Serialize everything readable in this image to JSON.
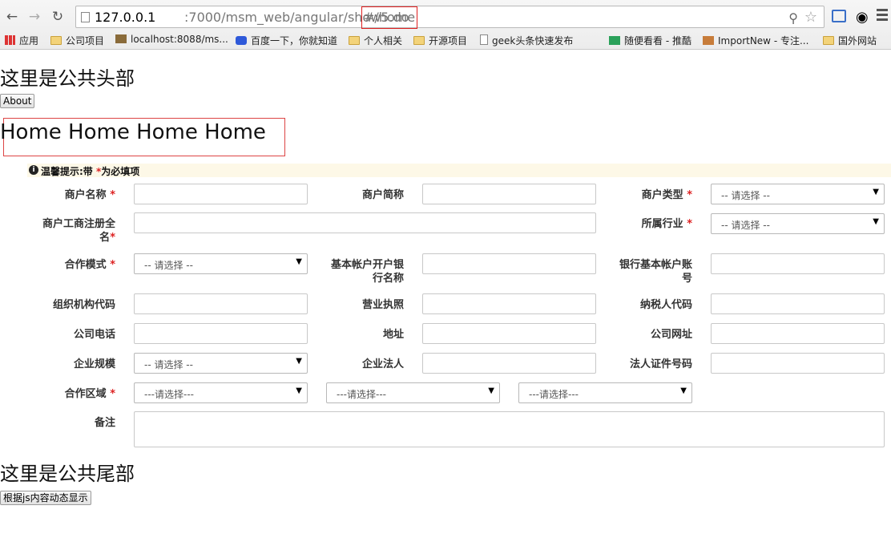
{
  "browser": {
    "back_icon": "back-arrow-icon",
    "forward_icon": "forward-arrow-icon",
    "reload_icon": "reload-icon",
    "url_host": "127.0.0.1",
    "url_path": ":7000/msm_web/angular/show5.do",
    "url_hash": "#/home",
    "bookmarks": [
      {
        "label": "应用",
        "icon": "apps-icon"
      },
      {
        "label": "公司项目",
        "icon": "folder-icon"
      },
      {
        "label": "localhost:8088/ms...",
        "icon": "favicon-icon"
      },
      {
        "label": "百度一下，你就知道",
        "icon": "paw-icon"
      },
      {
        "label": "个人相关",
        "icon": "folder-icon"
      },
      {
        "label": "开源项目",
        "icon": "folder-icon"
      },
      {
        "label": "geek头条快速发布",
        "icon": "page-icon"
      },
      {
        "label": "随便看看 - 推酷",
        "icon": "tuicool-icon"
      },
      {
        "label": "ImportNew - 专注...",
        "icon": "java-icon"
      },
      {
        "label": "国外网站",
        "icon": "folder-icon"
      }
    ]
  },
  "header": {
    "title": "这里是公共头部",
    "about_button": "About"
  },
  "home": {
    "heading": "Home Home Home Home"
  },
  "form": {
    "tip_icon": "info-icon",
    "tip_text_prefix": "温馨提示:带 ",
    "tip_star": "*",
    "tip_text_suffix": "为必填项",
    "required_mark": "*",
    "select_placeholder": "-- 请选择 --",
    "region_placeholder": "---请选择---",
    "labels": {
      "merchant_name": "商户名称",
      "merchant_short": "商户简称",
      "merchant_type": "商户类型",
      "merchant_reg_name_1": "商户工商注册全",
      "merchant_reg_name_2": "名",
      "industry": "所属行业",
      "coop_mode": "合作模式",
      "bank_name_1": "基本帐户开户银",
      "bank_name_2": "行名称",
      "bank_account_1": "银行基本帐户账",
      "bank_account_2": "号",
      "org_code": "组织机构代码",
      "business_license": "营业执照",
      "tax_code": "纳税人代码",
      "company_phone": "公司电话",
      "address": "地址",
      "company_website": "公司网址",
      "company_scale": "企业规模",
      "legal_person": "企业法人",
      "legal_id": "法人证件号码",
      "coop_region": "合作区域",
      "remark": "备注"
    }
  },
  "footer": {
    "title": "这里是公共尾部",
    "dynamic_button": "根据js内容动态显示"
  }
}
